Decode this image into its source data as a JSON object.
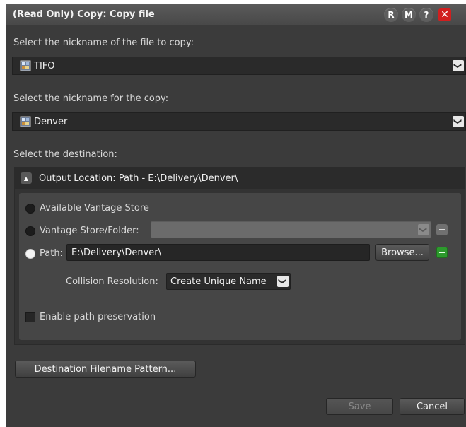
{
  "dialog": {
    "title": "(Read Only) Copy: Copy file",
    "title_buttons": {
      "r": "R",
      "m": "M",
      "help": "?",
      "close": "✕"
    }
  },
  "source": {
    "label": "Select the nickname of the file to copy:",
    "value": "TIFO"
  },
  "copy": {
    "label": "Select the nickname for the copy:",
    "value": "Denver"
  },
  "destination": {
    "label": "Select the destination:",
    "group_title": "Output Location: Path - E:\\Delivery\\Denver\\",
    "options": {
      "store": "Available Vantage Store",
      "store_folder": "Vantage Store/Folder:",
      "path": "Path:"
    },
    "selected_option": "path",
    "path_value": "E:\\Delivery\\Denver\\",
    "browse_label": "Browse...",
    "collision_label": "Collision Resolution:",
    "collision_value": "Create Unique Name",
    "preserve_label": "Enable path preservation",
    "preserve_checked": false
  },
  "pattern_button": "Destination Filename Pattern...",
  "footer": {
    "save": "Save",
    "cancel": "Cancel"
  },
  "icons": {
    "file": "file-image-icon",
    "dropdown": "chevron-down-icon",
    "collapse": "triangle-up-icon",
    "remove": "minus-icon",
    "add": "minus-green-icon"
  },
  "colors": {
    "background": "#3b3b3b",
    "close_red": "#d11f1f",
    "green_accent": "#2d9a2d"
  }
}
